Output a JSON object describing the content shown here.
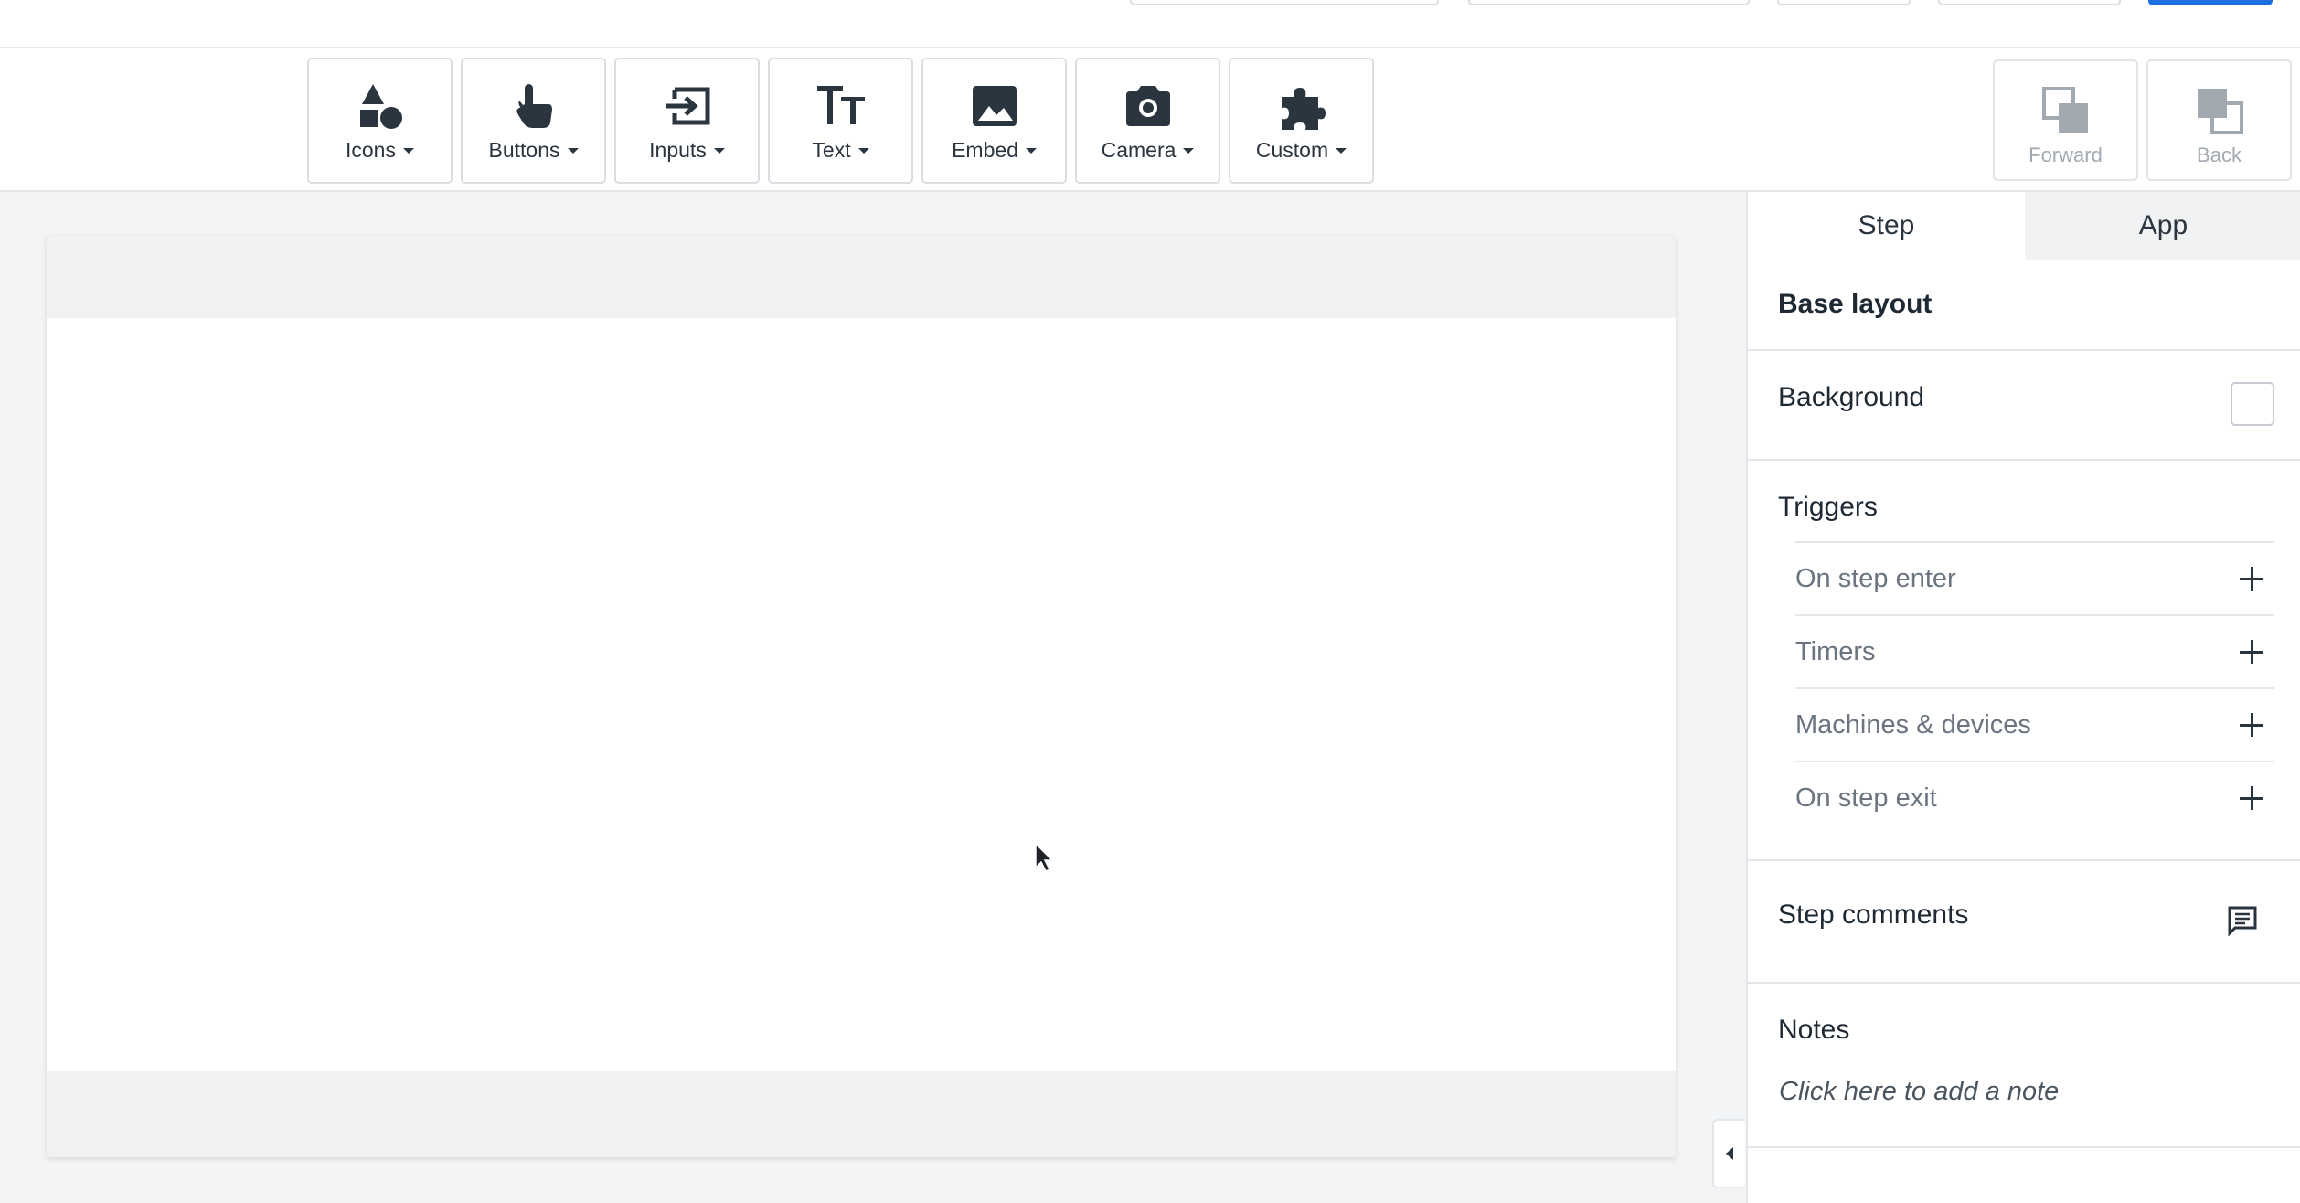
{
  "toolbar": {
    "tools": [
      {
        "label": "Icons",
        "icon": "shapes-icon"
      },
      {
        "label": "Buttons",
        "icon": "pointer-hand-icon"
      },
      {
        "label": "Inputs",
        "icon": "input-arrow-icon"
      },
      {
        "label": "Text",
        "icon": "text-size-icon"
      },
      {
        "label": "Embed",
        "icon": "image-icon"
      },
      {
        "label": "Camera",
        "icon": "camera-icon"
      },
      {
        "label": "Custom",
        "icon": "puzzle-icon"
      }
    ],
    "forward_label": "Forward",
    "back_label": "Back"
  },
  "panel": {
    "tabs": {
      "step": "Step",
      "app": "App"
    },
    "base_layout": "Base layout",
    "background_label": "Background",
    "triggers_title": "Triggers",
    "triggers": [
      "On step enter",
      "Timers",
      "Machines & devices",
      "On step exit"
    ],
    "step_comments": "Step comments",
    "notes_title": "Notes",
    "notes_placeholder": "Click here to add a note"
  },
  "colors": {
    "accent": "#1d6fe0",
    "icon_dark": "#2b3540",
    "canvas_bg": "#f3f4f6"
  }
}
